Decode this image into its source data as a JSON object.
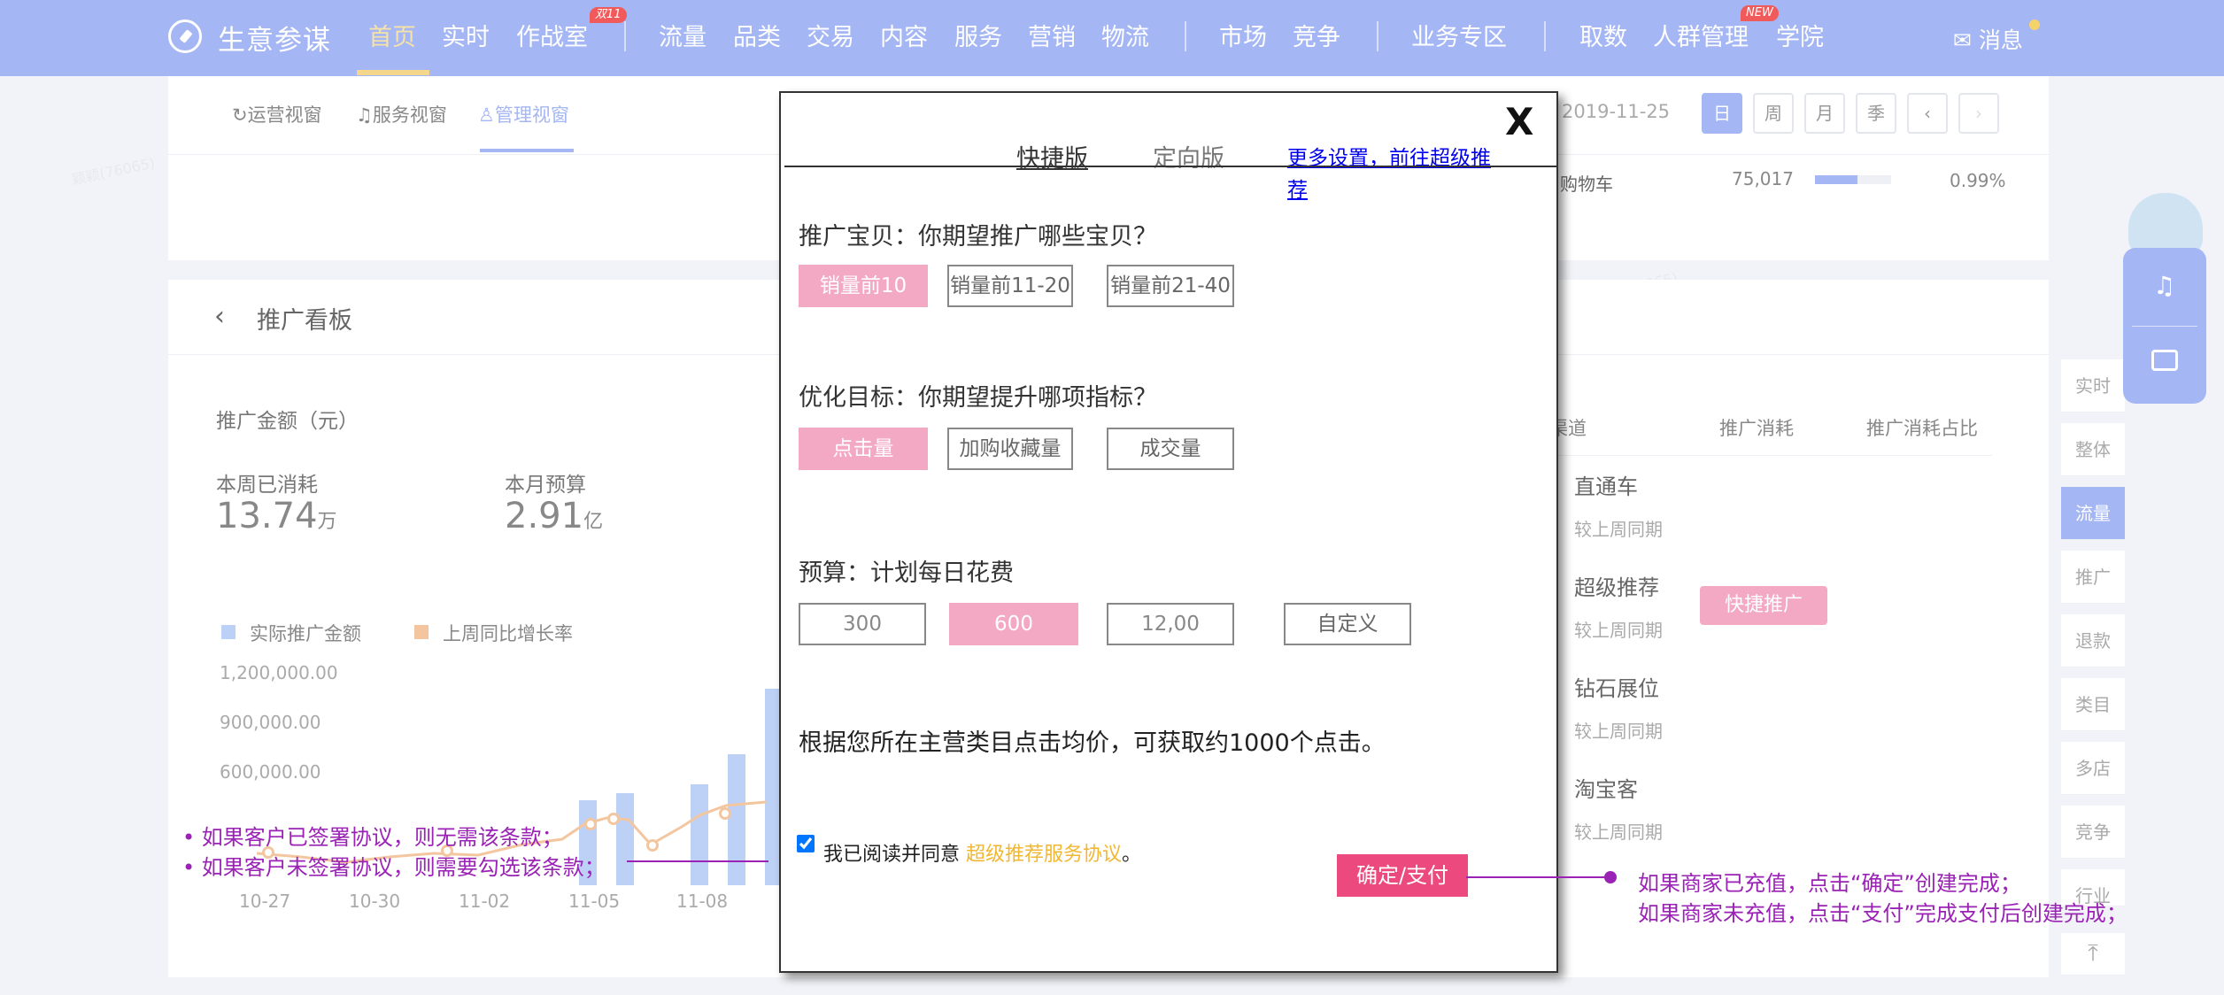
{
  "topbar": {
    "brand": "生意参谋",
    "nav": [
      "首页",
      "实时",
      "作战室",
      "流量",
      "品类",
      "交易",
      "内容",
      "服务",
      "营销",
      "物流",
      "市场",
      "竞争",
      "业务专区",
      "取数",
      "人群管理",
      "学院"
    ],
    "badge_double11": "双11",
    "badge_new": "NEW",
    "messages": "消息",
    "accent_color": "#a4b6f3"
  },
  "views": {
    "tabs": [
      "运营视窗",
      "服务视窗",
      "管理视窗"
    ],
    "date": "2019-11-25",
    "periods": [
      "日",
      "周",
      "月",
      "季"
    ]
  },
  "peek_row": {
    "label": "购物车",
    "value": "75,017",
    "percent": "0.99%"
  },
  "promo_board": {
    "title": "推广看板",
    "amount_label": "推广金额（元）",
    "week_spent_label": "本周已消耗",
    "week_spent_value": "13.74",
    "week_spent_unit": "万",
    "month_budget_label": "本月预算",
    "month_budget_value": "2.91",
    "month_budget_unit": "亿",
    "legend": [
      "实际推广金额",
      "上周同比增长率"
    ]
  },
  "chart_data": {
    "type": "bar",
    "series": [
      {
        "name": "实际推广金额",
        "color": "#bdd0f6"
      },
      {
        "name": "上周同比增长率",
        "color": "#f3c6a0"
      }
    ],
    "yticks": [
      "1,200,000.00",
      "900,000.00",
      "600,000.00"
    ],
    "xticks": [
      "10-27",
      "10-30",
      "11-02",
      "11-05",
      "11-08"
    ]
  },
  "channel_table": {
    "headers": [
      "渠道",
      "推广消耗",
      "推广消耗占比"
    ],
    "rows": [
      {
        "name": "直通车",
        "sub": "较上周同期"
      },
      {
        "name": "超级推荐",
        "sub": "较上周同期"
      },
      {
        "name": "钻石展位",
        "sub": "较上周同期"
      },
      {
        "name": "淘宝客",
        "sub": "较上周同期"
      }
    ],
    "quick_button": "快捷推广"
  },
  "right_rail": [
    "实时",
    "整体",
    "流量",
    "推广",
    "退款",
    "类目",
    "多店",
    "竞争",
    "行业"
  ],
  "modal": {
    "close": "X",
    "tabs": [
      "快捷版",
      "定向版"
    ],
    "more_link": "更多设置，前往超级推荐",
    "item_question": "推广宝贝：你期望推广哪些宝贝？",
    "item_options": [
      "销量前10",
      "销量前11-20",
      "销量前21-40"
    ],
    "goal_question": "优化目标：你期望提升哪项指标？",
    "goal_options": [
      "点击量",
      "加购收藏量",
      "成交量"
    ],
    "budget_question": "预算：计划每日花费",
    "budget_options": [
      "300",
      "600",
      "12,00",
      "自定义"
    ],
    "estimate": "根据您所在主营类目点击均价，可获取约1000个点击。",
    "agree_prefix": "我已阅读并同意",
    "agree_link": "超级推荐服务协议",
    "agree_suffix": "。",
    "confirm": "确定/支付",
    "highlight_color": "#f3a8c4",
    "confirm_color": "#ec4a7e"
  },
  "annotations": {
    "left": [
      "如果客户已签署协议，则无需该条款；",
      "如果客户未签署协议，则需要勾选该条款；"
    ],
    "right": [
      "如果商家已充值，点击“确定”创建完成；",
      "如果商家未充值，点击“支付”完成支付后创建完成；"
    ]
  }
}
